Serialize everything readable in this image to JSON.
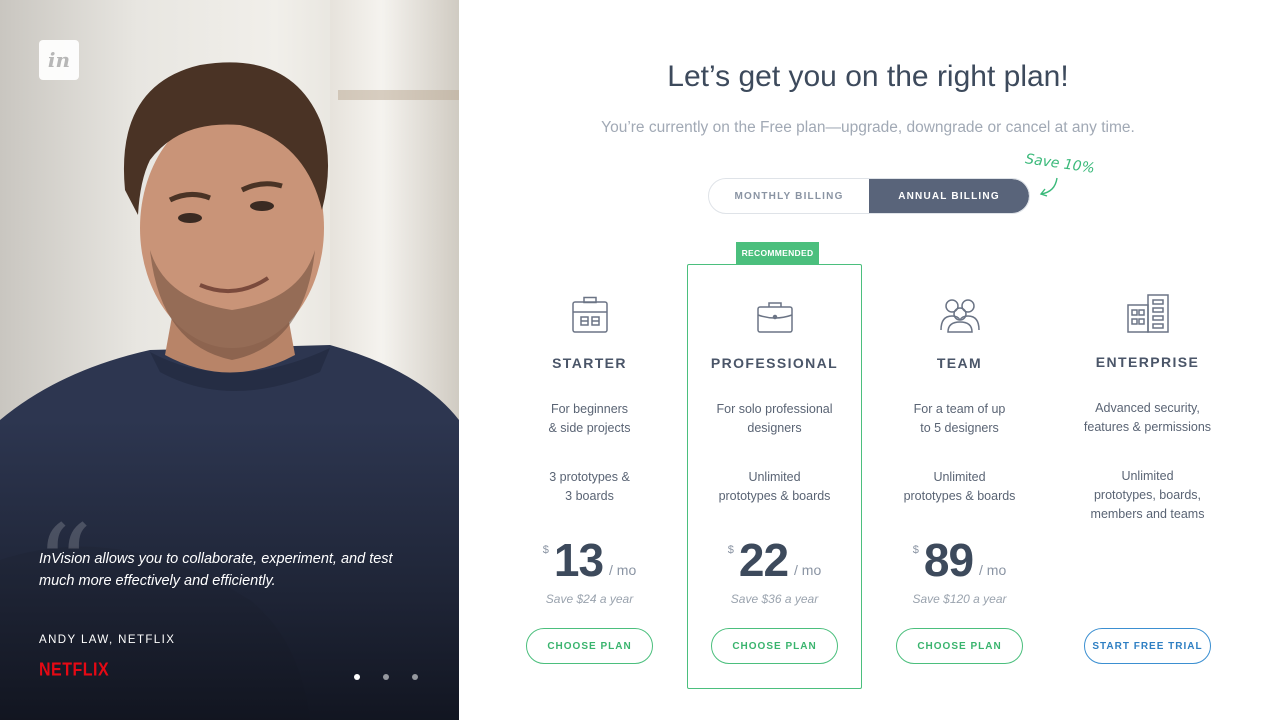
{
  "testimonial": {
    "logo": "in",
    "quote": "InVision allows you to collaborate, experiment, and test much more effectively and efficiently.",
    "author": "ANDY LAW, NETFLIX",
    "brand": "NETFLIX",
    "slides": 3,
    "active_slide": 1
  },
  "header": {
    "title": "Let’s get you on the right plan!",
    "subtitle": "You’re currently on the Free plan—upgrade, downgrade or cancel at any time."
  },
  "billing": {
    "monthly_label": "MONTHLY BILLING",
    "annual_label": "ANNUAL BILLING",
    "selected": "annual",
    "save_note": "Save 10%"
  },
  "recommended_label": "RECOMMENDED",
  "plans": [
    {
      "icon": "briefcase-tools-icon",
      "name": "STARTER",
      "desc": [
        "For beginners",
        "& side projects"
      ],
      "features": [
        "3 prototypes &",
        "3 boards"
      ],
      "currency": "$",
      "price": "13",
      "period": "/ mo",
      "save": "Save $24 a year",
      "button": "CHOOSE PLAN"
    },
    {
      "icon": "briefcase-icon",
      "name": "PROFESSIONAL",
      "desc": [
        "For solo professional",
        "designers"
      ],
      "features": [
        "Unlimited",
        "prototypes & boards"
      ],
      "currency": "$",
      "price": "22",
      "period": "/ mo",
      "save": "Save $36 a year",
      "button": "CHOOSE PLAN"
    },
    {
      "icon": "team-icon",
      "name": "TEAM",
      "desc": [
        "For a team of up",
        "to 5 designers"
      ],
      "features": [
        "Unlimited",
        "prototypes & boards"
      ],
      "currency": "$",
      "price": "89",
      "period": "/ mo",
      "save": "Save $120 a year",
      "button": "CHOOSE PLAN"
    },
    {
      "icon": "building-icon",
      "name": "ENTERPRISE",
      "desc": [
        "Advanced security,",
        "features & permissions"
      ],
      "features": [
        "Unlimited",
        "prototypes, boards,",
        "members and teams"
      ],
      "button": "START FREE TRIAL"
    }
  ],
  "colors": {
    "accent_green": "#4bbf7d",
    "accent_blue": "#3b8fd1",
    "toggle_active": "#59647a",
    "brand_red": "#e50914"
  }
}
